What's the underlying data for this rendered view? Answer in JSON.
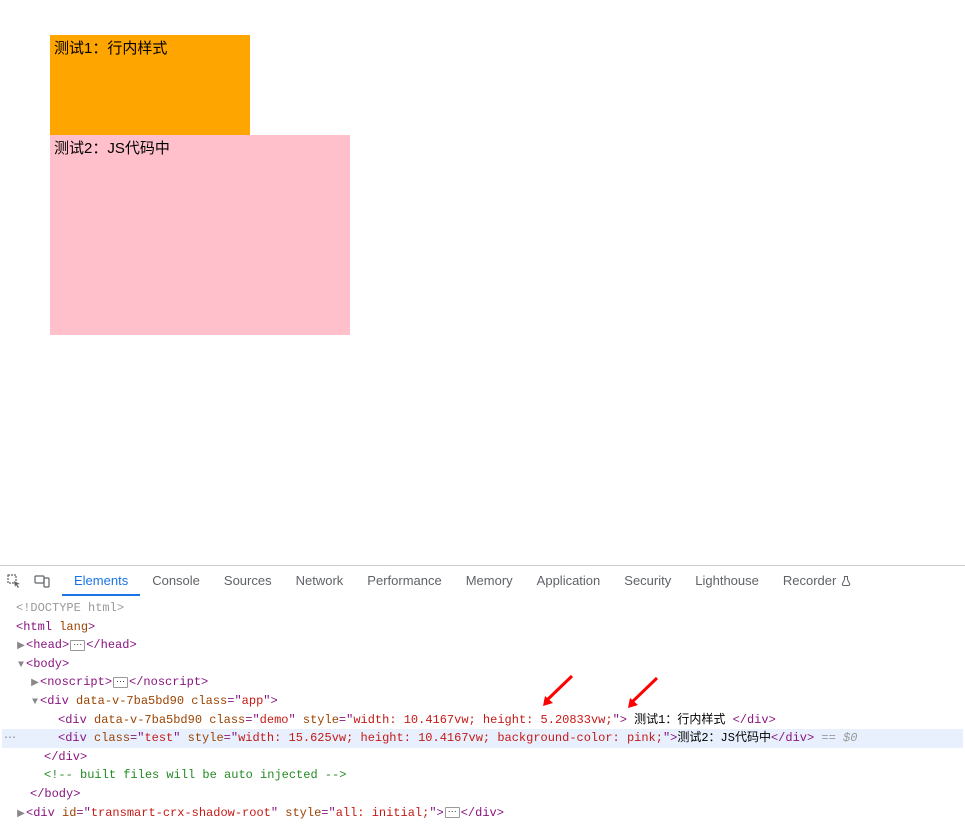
{
  "preview": {
    "box1_text": "测试1：行内样式",
    "box2_text": "测试2：JS代码中"
  },
  "devtools": {
    "tabs": [
      "Elements",
      "Console",
      "Sources",
      "Network",
      "Performance",
      "Memory",
      "Application",
      "Security",
      "Lighthouse",
      "Recorder"
    ],
    "active_tab": "Elements"
  },
  "dom": {
    "doctype": "<!DOCTYPE html>",
    "html_open": "html",
    "html_lang_attr": "lang",
    "head_tag": "head",
    "body_tag": "body",
    "noscript_tag": "noscript",
    "app_div": {
      "tag": "div",
      "data_attr": "data-v-7ba5bd90",
      "class_attr": "class",
      "class_val": "app"
    },
    "demo_div": {
      "tag": "div",
      "data_attr": "data-v-7ba5bd90",
      "class_attr": "class",
      "class_val": "demo",
      "style_attr": "style",
      "style_val": "width: 10.4167vw; height: 5.20833vw;",
      "text": "测试1：行内样式"
    },
    "test_div": {
      "tag": "div",
      "class_attr": "class",
      "class_val": "test",
      "style_attr": "style",
      "style_val": "width: 15.625vw; height: 10.4167vw; background-color: pink;",
      "text": "测试2：JS代码中"
    },
    "close_div": "div",
    "comment": " built files will be auto injected ",
    "close_body": "body",
    "shadow_div": {
      "tag": "div",
      "id_attr": "id",
      "id_val": "transmart-crx-shadow-root",
      "style_attr": "style",
      "style_val": "all: initial;"
    },
    "selected_marker": " == $0"
  }
}
